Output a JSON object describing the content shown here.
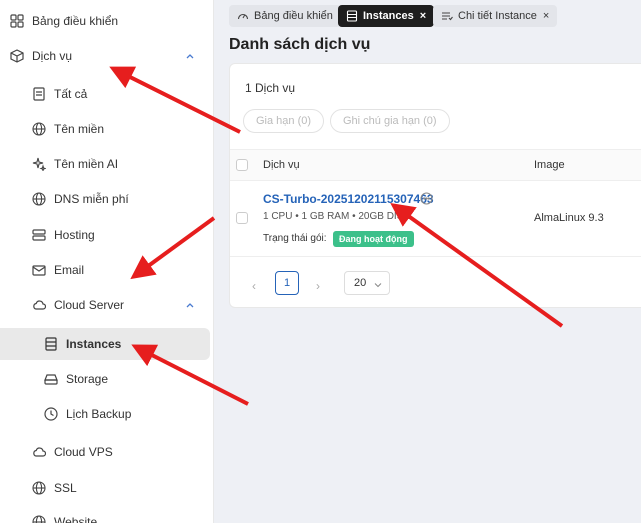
{
  "sidebar": {
    "items": [
      {
        "label": "Bảng điều khiển",
        "icon": "dashboard-icon"
      },
      {
        "label": "Dịch vụ",
        "icon": "box-icon"
      },
      {
        "label": "Tất cả",
        "icon": "document-icon"
      },
      {
        "label": "Tên miền",
        "icon": "globe-icon"
      },
      {
        "label": "Tên miền AI",
        "icon": "sparkle-icon"
      },
      {
        "label": "DNS miễn phí",
        "icon": "globe-icon"
      },
      {
        "label": "Hosting",
        "icon": "server-icon"
      },
      {
        "label": "Email",
        "icon": "mail-icon"
      },
      {
        "label": "Cloud Server",
        "icon": "cloud-icon"
      },
      {
        "label": "Instances",
        "icon": "list-icon"
      },
      {
        "label": "Storage",
        "icon": "storage-icon"
      },
      {
        "label": "Lịch Backup",
        "icon": "clock-icon"
      },
      {
        "label": "Cloud VPS",
        "icon": "cloud-icon"
      },
      {
        "label": "SSL",
        "icon": "globe-icon"
      },
      {
        "label": "Website",
        "icon": "globe-icon"
      }
    ]
  },
  "tabs": [
    {
      "label": "Bảng điều khiển",
      "icon": "gauge-icon"
    },
    {
      "label": "Instances",
      "icon": "list-icon",
      "close": "×"
    },
    {
      "label": "Chi tiết Instance",
      "icon": "detail-list-icon",
      "close": "×"
    }
  ],
  "page": {
    "title": "Danh sách dịch vụ"
  },
  "list": {
    "count": "1 Dịch vụ",
    "actions": {
      "renew": "Gia hạn (0)",
      "note": "Ghi chú gia hạn (0)"
    },
    "columns": {
      "service": "Dịch vụ",
      "image": "Image"
    },
    "rows": [
      {
        "name": "CS-Turbo-20251202115307463",
        "specs": "1 CPU  •  1 GB RAM  •  20GB DISK",
        "status_label": "Trạng thái gói:",
        "status": "Đang hoạt động",
        "image": "AlmaLinux 9.3"
      }
    ],
    "pagination": {
      "prev": "‹",
      "page": "1",
      "next": "›",
      "page_size": "20"
    }
  },
  "colors": {
    "accent": "#2563b8",
    "status_active": "#3cc08a",
    "annotation": "#e61e1e"
  }
}
